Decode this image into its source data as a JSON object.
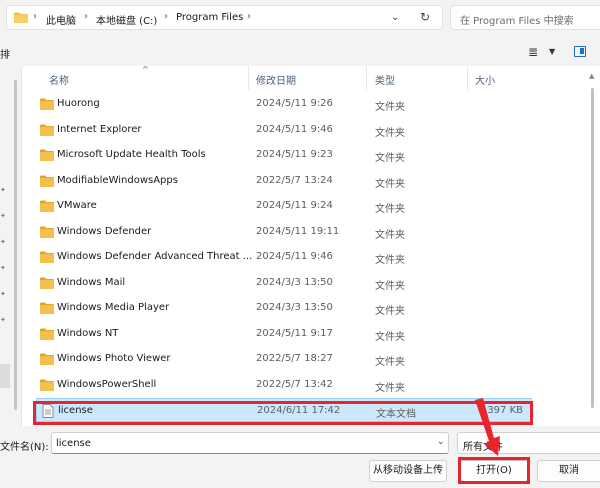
{
  "address": {
    "crumbs": [
      "此电脑",
      "本地磁盘 (C:)",
      "Program Files"
    ],
    "separator": "›",
    "dropdown_icon": "chevron-down-icon",
    "refresh_icon": "refresh-icon"
  },
  "search": {
    "placeholder": "在 Program Files 中搜索"
  },
  "toolbar": {
    "partial_label": "排"
  },
  "columns": {
    "name": "名称",
    "date": "修改日期",
    "type": "类型",
    "size": "大小"
  },
  "files": [
    {
      "name": "Huorong",
      "date": "2024/5/11 9:26",
      "type": "文件夹",
      "size": "",
      "kind": "folder",
      "selected": false
    },
    {
      "name": "Internet Explorer",
      "date": "2024/5/11 9:46",
      "type": "文件夹",
      "size": "",
      "kind": "folder",
      "selected": false
    },
    {
      "name": "Microsoft Update Health Tools",
      "date": "2024/5/11 9:23",
      "type": "文件夹",
      "size": "",
      "kind": "folder",
      "selected": false
    },
    {
      "name": "ModifiableWindowsApps",
      "date": "2022/5/7 13:24",
      "type": "文件夹",
      "size": "",
      "kind": "folder",
      "selected": false
    },
    {
      "name": "VMware",
      "date": "2024/5/11 9:24",
      "type": "文件夹",
      "size": "",
      "kind": "folder",
      "selected": false
    },
    {
      "name": "Windows Defender",
      "date": "2024/5/11 19:11",
      "type": "文件夹",
      "size": "",
      "kind": "folder",
      "selected": false
    },
    {
      "name": "Windows Defender Advanced Threat ...",
      "date": "2024/5/11 9:46",
      "type": "文件夹",
      "size": "",
      "kind": "folder",
      "selected": false
    },
    {
      "name": "Windows Mail",
      "date": "2024/3/3 13:50",
      "type": "文件夹",
      "size": "",
      "kind": "folder",
      "selected": false
    },
    {
      "name": "Windows Media Player",
      "date": "2024/3/3 13:50",
      "type": "文件夹",
      "size": "",
      "kind": "folder",
      "selected": false
    },
    {
      "name": "Windows NT",
      "date": "2024/5/11 9:17",
      "type": "文件夹",
      "size": "",
      "kind": "folder",
      "selected": false
    },
    {
      "name": "Windows Photo Viewer",
      "date": "2022/5/7 18:27",
      "type": "文件夹",
      "size": "",
      "kind": "folder",
      "selected": false
    },
    {
      "name": "WindowsPowerShell",
      "date": "2022/5/7 13:42",
      "type": "文件夹",
      "size": "",
      "kind": "folder",
      "selected": false
    },
    {
      "name": "license",
      "date": "2024/6/11 17:42",
      "type": "文本文档",
      "size": "397 KB",
      "kind": "file",
      "selected": true
    }
  ],
  "bottom": {
    "filename_label": "文件名(N):",
    "filename_value": "license",
    "filetype_value": "所有文件",
    "upload_label": "从移动设备上传",
    "open_label": "打开(O)",
    "cancel_label": "取消"
  },
  "colors": {
    "folder": "#f3c04b",
    "folder_dark": "#e0a52c",
    "selection": "#cce8ff",
    "highlight": "#e6262c",
    "accent": "#1f6fc4"
  }
}
